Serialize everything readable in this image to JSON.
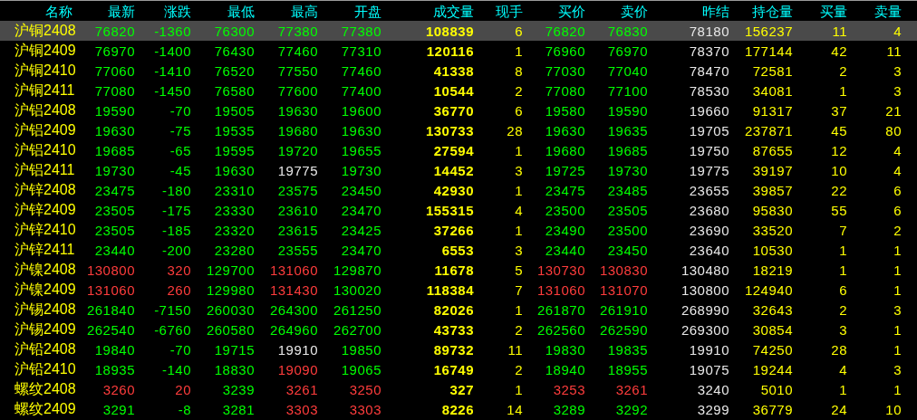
{
  "columns": [
    "名称",
    "最新",
    "涨跌",
    "最低",
    "最高",
    "开盘",
    "成交量",
    "现手",
    "买价",
    "卖价",
    "昨结",
    "持仓量",
    "买量",
    "卖量"
  ],
  "rows": [
    {
      "name": "沪铜2408",
      "selected": true,
      "cells": [
        {
          "text": "76820",
          "color": "#00ff00"
        },
        {
          "text": "-1360",
          "color": "#00ff00"
        },
        {
          "text": "76300",
          "color": "#00ff00"
        },
        {
          "text": "77380",
          "color": "#00ff00"
        },
        {
          "text": "77380",
          "color": "#00ff00"
        },
        "108839",
        "6",
        {
          "text": "76820",
          "color": "#00ff00"
        },
        {
          "text": "76830",
          "color": "#00ff00"
        },
        "78180",
        "156237",
        "11",
        "4"
      ]
    },
    {
      "name": "沪铜2409",
      "selected": false,
      "cells": [
        {
          "text": "76970",
          "color": "#00ff00"
        },
        {
          "text": "-1400",
          "color": "#00ff00"
        },
        {
          "text": "76430",
          "color": "#00ff00"
        },
        {
          "text": "77460",
          "color": "#00ff00"
        },
        {
          "text": "77310",
          "color": "#00ff00"
        },
        "120116",
        "1",
        {
          "text": "76960",
          "color": "#00ff00"
        },
        {
          "text": "76970",
          "color": "#00ff00"
        },
        "78370",
        "177144",
        "42",
        "11"
      ]
    },
    {
      "name": "沪铜2410",
      "selected": false,
      "cells": [
        {
          "text": "77060",
          "color": "#00ff00"
        },
        {
          "text": "-1410",
          "color": "#00ff00"
        },
        {
          "text": "76520",
          "color": "#00ff00"
        },
        {
          "text": "77550",
          "color": "#00ff00"
        },
        {
          "text": "77460",
          "color": "#00ff00"
        },
        "41338",
        "8",
        {
          "text": "77030",
          "color": "#00ff00"
        },
        {
          "text": "77040",
          "color": "#00ff00"
        },
        "78470",
        "72581",
        "2",
        "3"
      ]
    },
    {
      "name": "沪铜2411",
      "selected": false,
      "cells": [
        {
          "text": "77080",
          "color": "#00ff00"
        },
        {
          "text": "-1450",
          "color": "#00ff00"
        },
        {
          "text": "76580",
          "color": "#00ff00"
        },
        {
          "text": "77600",
          "color": "#00ff00"
        },
        {
          "text": "77400",
          "color": "#00ff00"
        },
        "10544",
        "2",
        {
          "text": "77080",
          "color": "#00ff00"
        },
        {
          "text": "77100",
          "color": "#00ff00"
        },
        "78530",
        "34081",
        "1",
        "3"
      ]
    },
    {
      "name": "沪铝2408",
      "selected": false,
      "cells": [
        {
          "text": "19590",
          "color": "#00ff00"
        },
        {
          "text": "-70",
          "color": "#00ff00"
        },
        {
          "text": "19505",
          "color": "#00ff00"
        },
        {
          "text": "19630",
          "color": "#00ff00"
        },
        {
          "text": "19600",
          "color": "#00ff00"
        },
        "36770",
        "6",
        {
          "text": "19580",
          "color": "#00ff00"
        },
        {
          "text": "19590",
          "color": "#00ff00"
        },
        "19660",
        "91317",
        "37",
        "21"
      ]
    },
    {
      "name": "沪铝2409",
      "selected": false,
      "cells": [
        {
          "text": "19630",
          "color": "#00ff00"
        },
        {
          "text": "-75",
          "color": "#00ff00"
        },
        {
          "text": "19535",
          "color": "#00ff00"
        },
        {
          "text": "19680",
          "color": "#00ff00"
        },
        {
          "text": "19630",
          "color": "#00ff00"
        },
        "130733",
        "28",
        {
          "text": "19630",
          "color": "#00ff00"
        },
        {
          "text": "19635",
          "color": "#00ff00"
        },
        "19705",
        "237871",
        "45",
        "80"
      ]
    },
    {
      "name": "沪铝2410",
      "selected": false,
      "cells": [
        {
          "text": "19685",
          "color": "#00ff00"
        },
        {
          "text": "-65",
          "color": "#00ff00"
        },
        {
          "text": "19595",
          "color": "#00ff00"
        },
        {
          "text": "19720",
          "color": "#00ff00"
        },
        {
          "text": "19655",
          "color": "#00ff00"
        },
        "27594",
        "1",
        {
          "text": "19680",
          "color": "#00ff00"
        },
        {
          "text": "19685",
          "color": "#00ff00"
        },
        "19750",
        "87655",
        "12",
        "4"
      ]
    },
    {
      "name": "沪铝2411",
      "selected": false,
      "cells": [
        {
          "text": "19730",
          "color": "#00ff00"
        },
        {
          "text": "-45",
          "color": "#00ff00"
        },
        {
          "text": "19630",
          "color": "#00ff00"
        },
        {
          "text": "19775",
          "color": "#e8e8e8"
        },
        {
          "text": "19730",
          "color": "#00ff00"
        },
        "14452",
        "3",
        {
          "text": "19725",
          "color": "#00ff00"
        },
        {
          "text": "19730",
          "color": "#00ff00"
        },
        "19775",
        "39197",
        "10",
        "4"
      ]
    },
    {
      "name": "沪锌2408",
      "selected": false,
      "cells": [
        {
          "text": "23475",
          "color": "#00ff00"
        },
        {
          "text": "-180",
          "color": "#00ff00"
        },
        {
          "text": "23310",
          "color": "#00ff00"
        },
        {
          "text": "23575",
          "color": "#00ff00"
        },
        {
          "text": "23450",
          "color": "#00ff00"
        },
        "42930",
        "1",
        {
          "text": "23475",
          "color": "#00ff00"
        },
        {
          "text": "23485",
          "color": "#00ff00"
        },
        "23655",
        "39857",
        "22",
        "6"
      ]
    },
    {
      "name": "沪锌2409",
      "selected": false,
      "cells": [
        {
          "text": "23505",
          "color": "#00ff00"
        },
        {
          "text": "-175",
          "color": "#00ff00"
        },
        {
          "text": "23330",
          "color": "#00ff00"
        },
        {
          "text": "23610",
          "color": "#00ff00"
        },
        {
          "text": "23470",
          "color": "#00ff00"
        },
        "155315",
        "4",
        {
          "text": "23500",
          "color": "#00ff00"
        },
        {
          "text": "23505",
          "color": "#00ff00"
        },
        "23680",
        "95830",
        "55",
        "6"
      ]
    },
    {
      "name": "沪锌2410",
      "selected": false,
      "cells": [
        {
          "text": "23505",
          "color": "#00ff00"
        },
        {
          "text": "-185",
          "color": "#00ff00"
        },
        {
          "text": "23320",
          "color": "#00ff00"
        },
        {
          "text": "23615",
          "color": "#00ff00"
        },
        {
          "text": "23425",
          "color": "#00ff00"
        },
        "37266",
        "1",
        {
          "text": "23490",
          "color": "#00ff00"
        },
        {
          "text": "23500",
          "color": "#00ff00"
        },
        "23690",
        "33520",
        "7",
        "2"
      ]
    },
    {
      "name": "沪锌2411",
      "selected": false,
      "cells": [
        {
          "text": "23440",
          "color": "#00ff00"
        },
        {
          "text": "-200",
          "color": "#00ff00"
        },
        {
          "text": "23280",
          "color": "#00ff00"
        },
        {
          "text": "23555",
          "color": "#00ff00"
        },
        {
          "text": "23470",
          "color": "#00ff00"
        },
        "6553",
        "3",
        {
          "text": "23440",
          "color": "#00ff00"
        },
        {
          "text": "23450",
          "color": "#00ff00"
        },
        "23640",
        "10530",
        "1",
        "1"
      ]
    },
    {
      "name": "沪镍2408",
      "selected": false,
      "cells": [
        {
          "text": "130800",
          "color": "#ff3c3c"
        },
        {
          "text": "320",
          "color": "#ff3c3c"
        },
        {
          "text": "129700",
          "color": "#00ff00"
        },
        {
          "text": "131060",
          "color": "#ff3c3c"
        },
        {
          "text": "129870",
          "color": "#00ff00"
        },
        "11678",
        "5",
        {
          "text": "130730",
          "color": "#ff3c3c"
        },
        {
          "text": "130830",
          "color": "#ff3c3c"
        },
        "130480",
        "18219",
        "1",
        "1"
      ]
    },
    {
      "name": "沪镍2409",
      "selected": false,
      "cells": [
        {
          "text": "131060",
          "color": "#ff3c3c"
        },
        {
          "text": "260",
          "color": "#ff3c3c"
        },
        {
          "text": "129980",
          "color": "#00ff00"
        },
        {
          "text": "131430",
          "color": "#ff3c3c"
        },
        {
          "text": "130020",
          "color": "#00ff00"
        },
        "118384",
        "7",
        {
          "text": "131060",
          "color": "#ff3c3c"
        },
        {
          "text": "131070",
          "color": "#ff3c3c"
        },
        "130800",
        "124940",
        "6",
        "1"
      ]
    },
    {
      "name": "沪锡2408",
      "selected": false,
      "cells": [
        {
          "text": "261840",
          "color": "#00ff00"
        },
        {
          "text": "-7150",
          "color": "#00ff00"
        },
        {
          "text": "260030",
          "color": "#00ff00"
        },
        {
          "text": "264300",
          "color": "#00ff00"
        },
        {
          "text": "261250",
          "color": "#00ff00"
        },
        "82026",
        "1",
        {
          "text": "261870",
          "color": "#00ff00"
        },
        {
          "text": "261910",
          "color": "#00ff00"
        },
        "268990",
        "32643",
        "2",
        "3"
      ]
    },
    {
      "name": "沪锡2409",
      "selected": false,
      "cells": [
        {
          "text": "262540",
          "color": "#00ff00"
        },
        {
          "text": "-6760",
          "color": "#00ff00"
        },
        {
          "text": "260580",
          "color": "#00ff00"
        },
        {
          "text": "264960",
          "color": "#00ff00"
        },
        {
          "text": "262700",
          "color": "#00ff00"
        },
        "43733",
        "2",
        {
          "text": "262560",
          "color": "#00ff00"
        },
        {
          "text": "262590",
          "color": "#00ff00"
        },
        "269300",
        "30854",
        "3",
        "1"
      ]
    },
    {
      "name": "沪铅2408",
      "selected": false,
      "cells": [
        {
          "text": "19840",
          "color": "#00ff00"
        },
        {
          "text": "-70",
          "color": "#00ff00"
        },
        {
          "text": "19715",
          "color": "#00ff00"
        },
        {
          "text": "19910",
          "color": "#e8e8e8"
        },
        {
          "text": "19850",
          "color": "#00ff00"
        },
        "89732",
        "11",
        {
          "text": "19830",
          "color": "#00ff00"
        },
        {
          "text": "19835",
          "color": "#00ff00"
        },
        "19910",
        "74250",
        "28",
        "1"
      ]
    },
    {
      "name": "沪铅2410",
      "selected": false,
      "cells": [
        {
          "text": "18935",
          "color": "#00ff00"
        },
        {
          "text": "-140",
          "color": "#00ff00"
        },
        {
          "text": "18830",
          "color": "#00ff00"
        },
        {
          "text": "19090",
          "color": "#ff3c3c"
        },
        {
          "text": "19065",
          "color": "#00ff00"
        },
        "16749",
        "2",
        {
          "text": "18940",
          "color": "#00ff00"
        },
        {
          "text": "18955",
          "color": "#00ff00"
        },
        "19075",
        "19244",
        "4",
        "3"
      ]
    },
    {
      "name": "螺纹2408",
      "selected": false,
      "cells": [
        {
          "text": "3260",
          "color": "#ff3c3c"
        },
        {
          "text": "20",
          "color": "#ff3c3c"
        },
        {
          "text": "3239",
          "color": "#00ff00"
        },
        {
          "text": "3261",
          "color": "#ff3c3c"
        },
        {
          "text": "3250",
          "color": "#ff3c3c"
        },
        "327",
        "1",
        {
          "text": "3253",
          "color": "#ff3c3c"
        },
        {
          "text": "3261",
          "color": "#ff3c3c"
        },
        "3240",
        "5010",
        "1",
        "1"
      ]
    },
    {
      "name": "螺纹2409",
      "selected": false,
      "cells": [
        {
          "text": "3291",
          "color": "#00ff00"
        },
        {
          "text": "-8",
          "color": "#00ff00"
        },
        {
          "text": "3281",
          "color": "#00ff00"
        },
        {
          "text": "3303",
          "color": "#ff3c3c"
        },
        {
          "text": "3303",
          "color": "#ff3c3c"
        },
        "8226",
        "14",
        {
          "text": "3289",
          "color": "#00ff00"
        },
        {
          "text": "3292",
          "color": "#00ff00"
        },
        "3299",
        "36779",
        "24",
        "10"
      ]
    }
  ]
}
